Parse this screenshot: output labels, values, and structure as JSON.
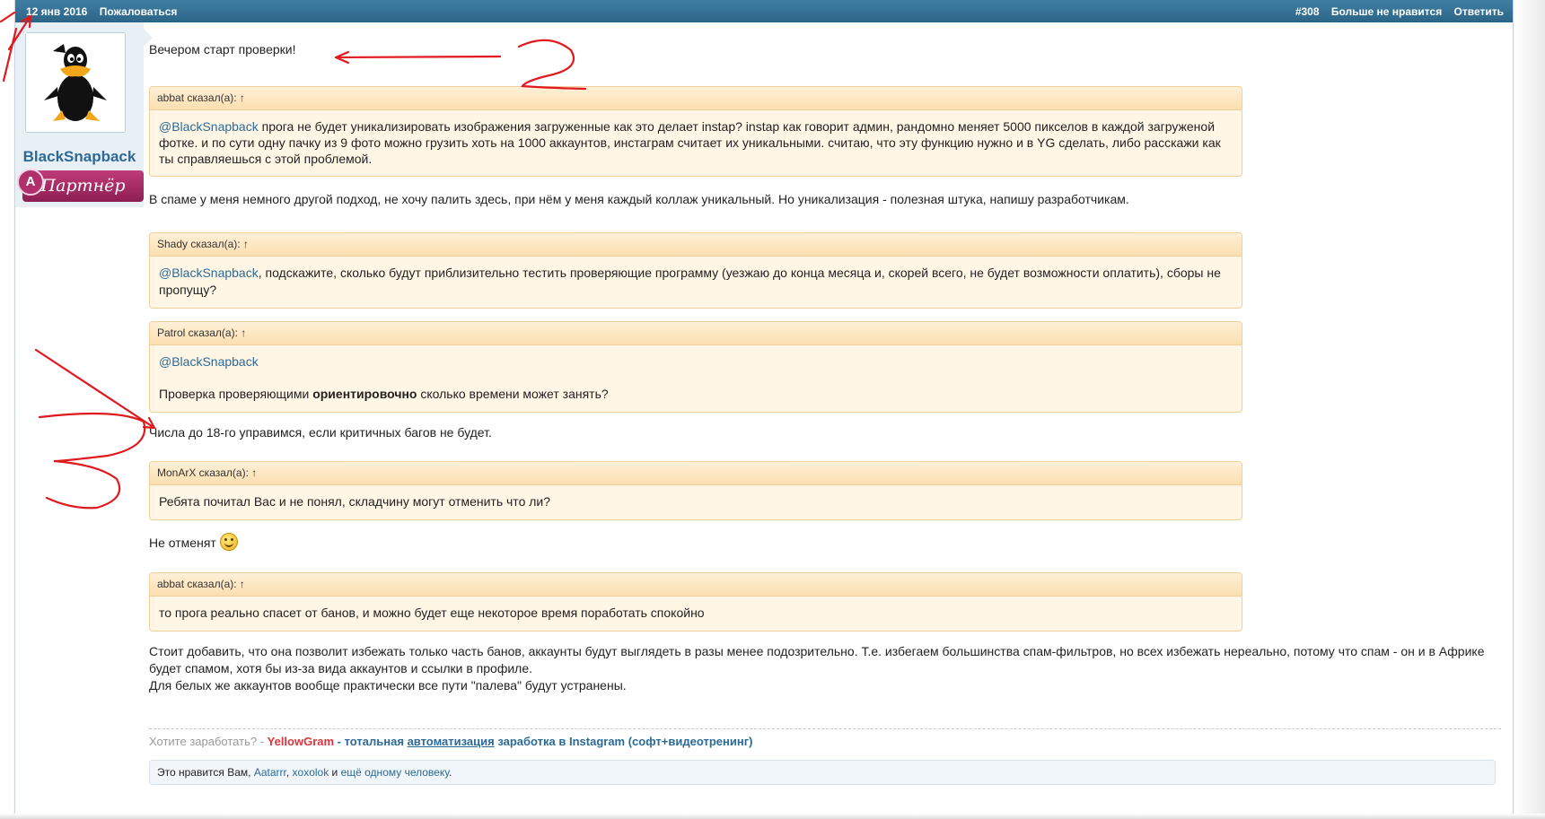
{
  "topbar": {
    "date": "12 янв 2016",
    "report": "Пожаловаться",
    "post_number": "#308",
    "unlike": "Больше не нравится",
    "reply": "Ответить"
  },
  "user": {
    "name": "BlackSnapback",
    "badge_letter": "A",
    "title": "Партнёр"
  },
  "message": {
    "intro": "Вечером старт проверки!",
    "q1_author": "abbat сказал(а): ↑",
    "q1_mention": "@BlackSnapback",
    "q1_text": " прога не будет уникализировать изображения загруженные как это делает instap? instap как говорит админ, рандомно меняет 5000 пикселов в каждой загруженой фотке. и по сути одну пачку из 9 фото можно грузить хоть на 1000 аккаунтов, инстаграм считает их уникальными. считаю, что эту функцию нужно и в YG сделать, либо расскажи как ты справляешься с этой проблемой.",
    "a1": "В спаме у меня немного другой подход, не хочу палить здесь, при нём у меня каждый коллаж уникальный. Но уникализация - полезная штука, напишу разработчикам.",
    "q2_author": "Shady сказал(а): ↑",
    "q2_mention": "@BlackSnapback",
    "q2_text": ", подскажите, сколько будут приблизительно тестить проверяющие программу (уезжаю до конца месяца и, скорей всего, не будет возможности оплатить), сборы не пропущу?",
    "q3_author": "Patrol сказал(а): ↑",
    "q3_mention": "@BlackSnapback",
    "q3_text_a": "Проверка проверяющими ",
    "q3_bold": "ориентировочно",
    "q3_text_b": " сколько времени может занять?",
    "a3": "Числа до 18-го управимся, если критичных багов не будет.",
    "q4_author": "MonArX сказал(а): ↑",
    "q4_text": "Ребята почитал Вас и не понял, складчину могут отменить что ли?",
    "a4": "Не отменят ",
    "q5_author": "abbat сказал(а): ↑",
    "q5_text": "то прога реально спасет от банов, и можно будет еще некоторое время поработать спокойно",
    "final_1": "Стоит добавить, что она позволит избежать только часть банов, аккаунты будут выглядеть в разы менее подозрительно. Т.е. избегаем большинства спам-фильтров, но всех избежать нереально, потому что спам - он и в Африке будет спамом, хотя бы из-за вида аккаунтов и ссылки в профиле.",
    "final_2": "Для белых же аккаунтов вообще практически все пути \"палева\" будут устранены."
  },
  "signature": {
    "lead": "Хотите заработать? - ",
    "brand": "YellowGram",
    "mid": " - тотальная ",
    "link": "автоматизация",
    "tail": " заработка в Instagram (софт+видеотренинг)"
  },
  "likes": {
    "prefix": "Это нравится Вам, ",
    "user1": "Aatarrr",
    "sep": ", ",
    "user2": "xoxolok",
    "and": " и ",
    "more": "ещё одному человеку",
    "end": "."
  },
  "annotation_color": "#e0191f",
  "accent_color": "#2b6a97",
  "icons": [
    "duck-avatar",
    "smiley-icon",
    "up-arrow-icon"
  ]
}
